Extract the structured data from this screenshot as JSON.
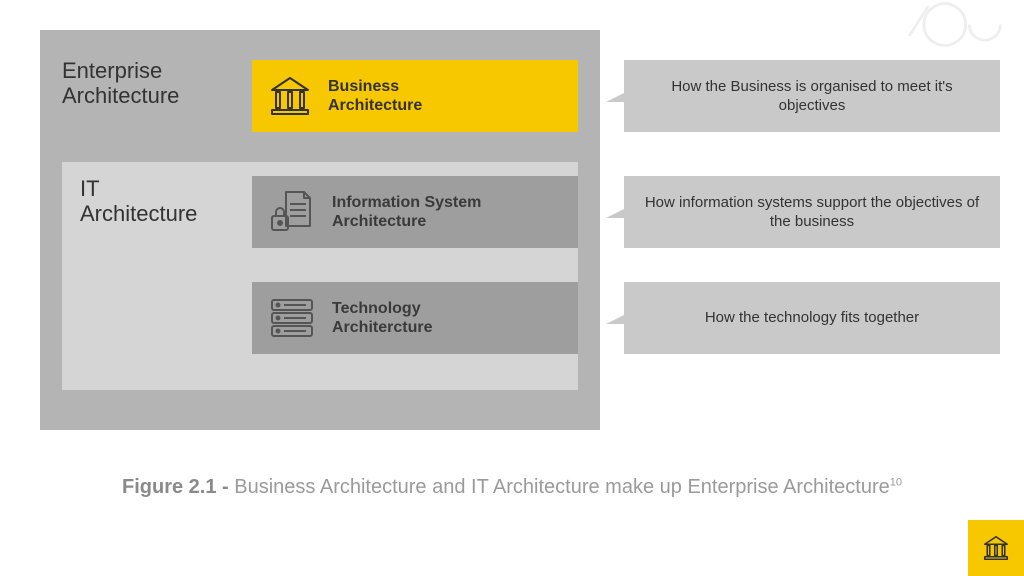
{
  "enterprise_label_l1": "Enterprise",
  "enterprise_label_l2": "Architecture",
  "it_label_l1": "IT",
  "it_label_l2": "Architecture",
  "blocks": {
    "business": {
      "l1": "Business",
      "l2": "Architecture"
    },
    "infosys": {
      "l1": "Information System",
      "l2": "Architecture"
    },
    "tech": {
      "l1": "Technology",
      "l2": "Architercture"
    }
  },
  "callouts": {
    "c1": "How the Business is organised to meet it's objectives",
    "c2": "How information systems support the objectives of the business",
    "c3": "How the technology fits together"
  },
  "caption_prefix": "Figure 2.1 -",
  "caption_text": " Business Architecture and IT Architecture make up Enterprise Architecture",
  "caption_sup": "10"
}
